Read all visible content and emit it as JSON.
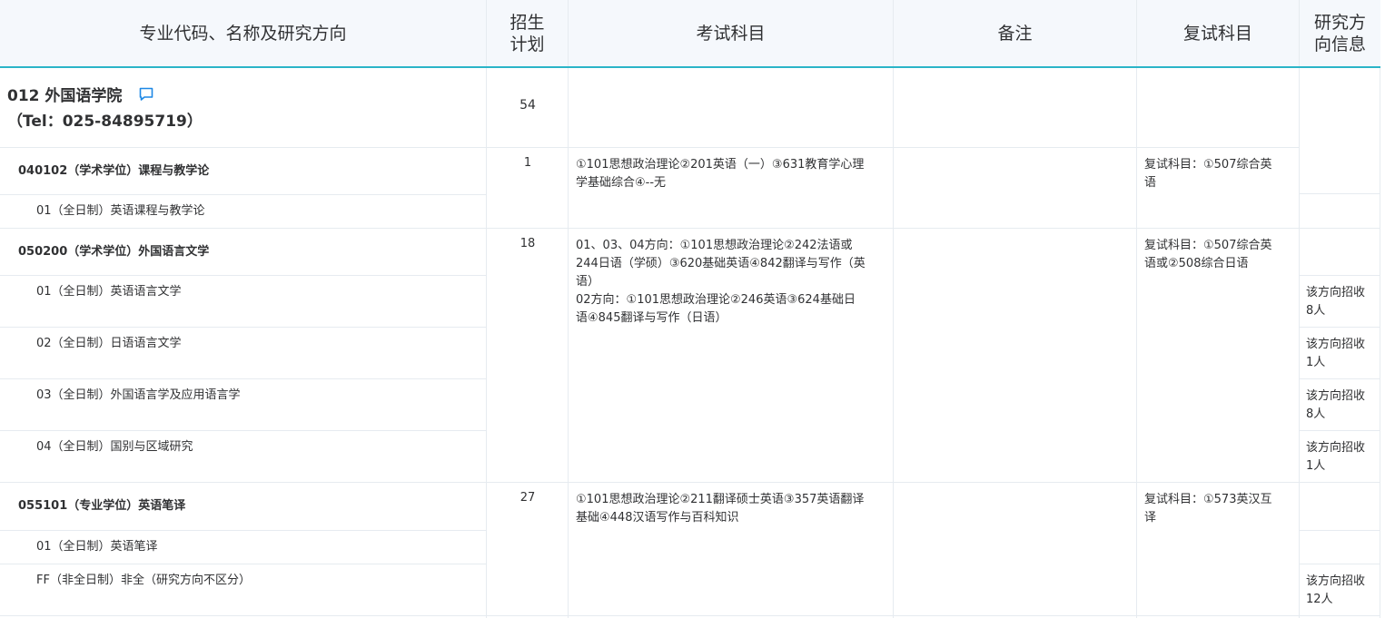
{
  "header": {
    "col_major": "专业代码、名称及研究方向",
    "col_plan_line1": "招生",
    "col_plan_line2": "计划",
    "col_exam": "考试科目",
    "col_remark": "备注",
    "col_retest": "复试科目",
    "col_dir_line1": "研究方",
    "col_dir_line2": "向信息"
  },
  "college": {
    "name": "012 外国语学院",
    "tel": "（Tel：025-84895719）",
    "plan": "54"
  },
  "majors": [
    {
      "title": "040102（学术学位）课程与教学论",
      "plan": "1",
      "exam": [
        "①101思想政治理论②201英语（一）③631教育学心理",
        "学基础综合④--无"
      ],
      "retest": [
        "复试科目：①507综合英",
        "语"
      ],
      "directions": [
        {
          "name": "01（全日制）英语课程与教学论",
          "info": [
            "",
            ""
          ]
        }
      ]
    },
    {
      "title": "050200（学术学位）外国语言文学",
      "plan": "18",
      "exam": [
        "01、03、04方向：①101思想政治理论②242法语或",
        "244日语（学硕）③620基础英语④842翻译与写作（英",
        "语）",
        "02方向：①101思想政治理论②246英语③624基础日",
        "语④845翻译与写作（日语）"
      ],
      "retest": [
        "复试科目：①507综合英",
        "语或②508综合日语"
      ],
      "directions": [
        {
          "name": "01（全日制）英语语言文学",
          "info": [
            "该方向招收",
            "8人"
          ]
        },
        {
          "name": "02（全日制）日语语言文学",
          "info": [
            "该方向招收",
            "1人"
          ]
        },
        {
          "name": "03（全日制）外国语言学及应用语言学",
          "info": [
            "该方向招收",
            "8人"
          ]
        },
        {
          "name": "04（全日制）国别与区域研究",
          "info": [
            "该方向招收",
            "1人"
          ]
        }
      ]
    },
    {
      "title": "055101（专业学位）英语笔译",
      "plan": "27",
      "exam": [
        "①101思想政治理论②211翻译硕士英语③357英语翻译",
        "基础④448汉语写作与百科知识"
      ],
      "retest": [
        "复试科目：①573英汉互",
        "译"
      ],
      "directions": [
        {
          "name": "01（全日制）英语笔译",
          "info": [
            "",
            ""
          ]
        },
        {
          "name": "FF（非全日制）非全（研究方向不区分）",
          "info": [
            "该方向招收",
            "12人"
          ]
        }
      ]
    }
  ],
  "colors": {
    "accent": "#2bb5c8",
    "icon": "#1e88e5",
    "header_bg": "#f5f8fc",
    "grid": "#e6ebf0"
  }
}
